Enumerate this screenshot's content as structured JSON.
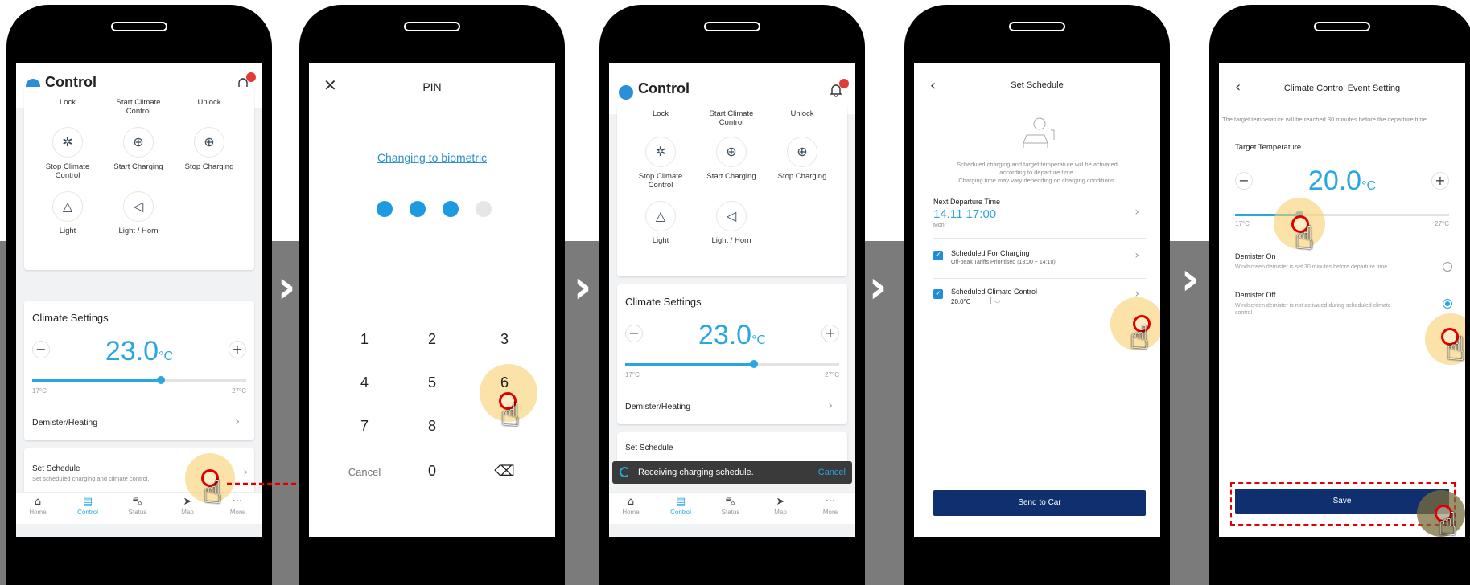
{
  "colors": {
    "accent": "#2aa6e0",
    "button": "#0f2f6e",
    "highlight": "#f7ce6e",
    "tap_ring": "#e10000"
  },
  "separator": "›",
  "control": {
    "title": "Control",
    "actions": [
      {
        "label": "Lock",
        "icon": "lock-icon"
      },
      {
        "label": "Start Climate Control",
        "icon": "fan-icon"
      },
      {
        "label": "Unlock",
        "icon": "unlock-icon"
      },
      {
        "label": "Stop Climate Control",
        "icon": "fan-off-icon"
      },
      {
        "label": "Start Charging",
        "icon": "plug-icon"
      },
      {
        "label": "Stop Charging",
        "icon": "plug-stop-icon"
      },
      {
        "label": "Light",
        "icon": "warning-light-icon"
      },
      {
        "label": "Light / Horn",
        "icon": "horn-icon"
      }
    ],
    "climate_title": "Climate Settings",
    "temp": "23.0",
    "unit": "°C",
    "min": "17°C",
    "max": "27°C",
    "temp_fraction": 0.6,
    "demister": "Demister/Heating",
    "schedule_title": "Set Schedule",
    "schedule_sub": "Set scheduled charging and climate control.",
    "schedule_title_partial": "Set Schedule",
    "toast": "Receiving charging schedule.",
    "toast_cancel": "Cancel",
    "nav": [
      {
        "label": "Home",
        "icon": "home-icon"
      },
      {
        "label": "Control",
        "icon": "control-icon"
      },
      {
        "label": "Status",
        "icon": "car-icon"
      },
      {
        "label": "Map",
        "icon": "navigation-icon"
      },
      {
        "label": "More",
        "icon": "more-icon"
      }
    ]
  },
  "pin": {
    "title": "PIN",
    "biometric": "Changing to biometric",
    "filled": 3,
    "total": 4,
    "keys": [
      "1",
      "2",
      "3",
      "4",
      "5",
      "6",
      "7",
      "8",
      "9",
      "Cancel",
      "0",
      "⌫"
    ]
  },
  "schedule": {
    "title": "Set Schedule",
    "desc1": "Scheduled charging and target temperature will be activated",
    "desc2": "according to departure time.",
    "desc3": "Charging time may vary depending on charging conditions.",
    "next_label": "Next Departure Time",
    "next_value": "14.11 17:00",
    "next_day": "Mon",
    "charging_label": "Scheduled For Charging",
    "charging_sub": "Off-peak Tariffs Prioritised (13:00 ~ 14:10)",
    "climate_label": "Scheduled Climate Control",
    "climate_sub": "20.0°C",
    "send": "Send to Car"
  },
  "event": {
    "title": "Climate Control Event Setting",
    "note": "The target temperature will be reached 30 minutes before the departure time.",
    "target_label": "Target Temperature",
    "temp": "20.0",
    "unit": "°C",
    "min": "17°C",
    "max": "27°C",
    "temp_fraction": 0.3,
    "on_label": "Demister On",
    "on_sub": "Windscreen demister is set 30 minutes before departure time.",
    "off_label": "Demister Off",
    "off_sub": "Windscreen demister is not activated during scheduled climate control",
    "save": "Save"
  }
}
